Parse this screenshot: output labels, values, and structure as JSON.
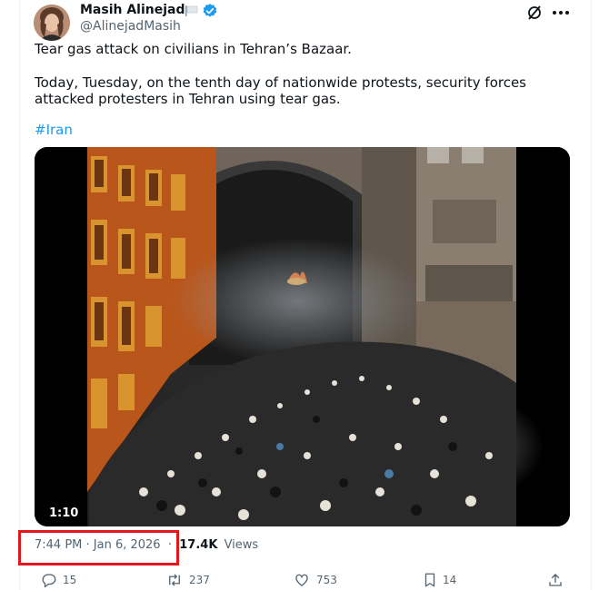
{
  "author": {
    "name": "Masih Alinejad",
    "handle": "@AlinejadMasih"
  },
  "tweet": {
    "line1": "Tear gas attack on civilians in Tehran’s Bazaar.",
    "line2": "Today, Tuesday, on the tenth day of nationwide protests, security forces",
    "line3": "attacked protesters in Tehran using tear gas.",
    "hashtag": "#Iran"
  },
  "media": {
    "duration": "1:10"
  },
  "meta": {
    "timestamp": "7:44 PM · Jan 6, 2026",
    "views_count": "17.4K",
    "views_label": "Views"
  },
  "actions": {
    "replies": "15",
    "reposts": "237",
    "likes": "753",
    "bookmarks": "14"
  },
  "colors": {
    "accent": "#1d9bf0",
    "highlight": "#e3161b",
    "muted": "#536471"
  },
  "icons": [
    "flag-icon",
    "verified-badge-icon",
    "grok-icon",
    "more-icon",
    "reply-icon",
    "repost-icon",
    "like-icon",
    "bookmark-icon",
    "share-icon"
  ]
}
